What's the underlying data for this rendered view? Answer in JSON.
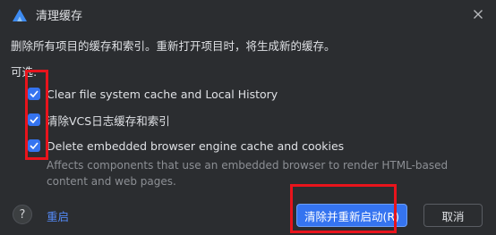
{
  "dialog": {
    "title": "清理缓存",
    "description": "删除所有项目的缓存和索引。重新打开项目时，将生成新的缓存。",
    "options_label": "可选:",
    "options": [
      {
        "label": "Clear file system cache and Local History",
        "checked": true
      },
      {
        "label": "清除VCS日志缓存和索引",
        "checked": true
      },
      {
        "label": "Delete embedded browser engine cache and cookies",
        "checked": true
      }
    ],
    "hint": "Affects components that use an embedded browser to render HTML-based content and web pages.",
    "help_label": "?",
    "restart_link": "重启",
    "primary_button": "清除并重新启动(R)",
    "cancel_button": "取消"
  },
  "colors": {
    "background": "#2b2d30",
    "accent": "#3574f0",
    "link": "#548af7",
    "annotation": "#e8141c"
  },
  "icons": {
    "app": "app-logo-icon",
    "close": "close-icon",
    "check": "check-icon",
    "help": "help-icon"
  }
}
